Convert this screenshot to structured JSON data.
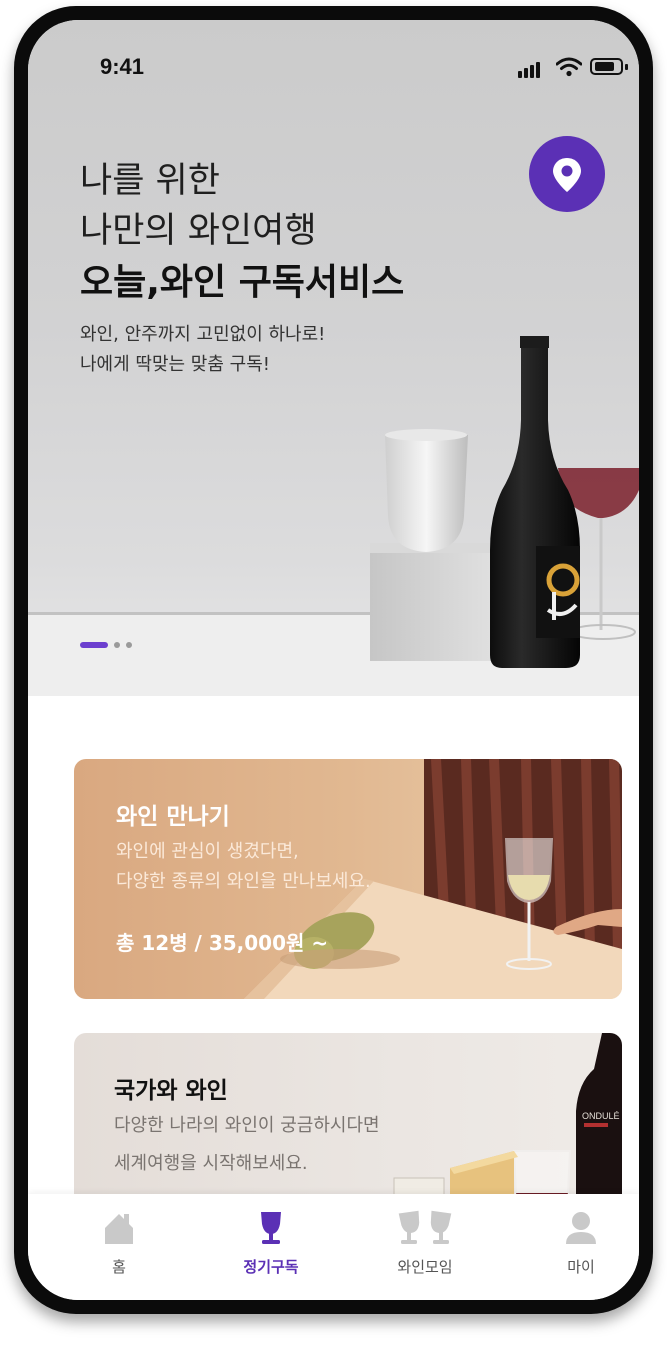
{
  "status": {
    "time": "9:41"
  },
  "hero": {
    "line1": "나를 위한",
    "line2": "나만의 와인여행",
    "line3": "오늘,와인 구독서비스",
    "desc1": "와인, 안주까지 고민없이  하나로!",
    "desc2": "나에게 딱맞는 맞춤 구독!",
    "location_icon": "location-pin-icon",
    "carousel": {
      "total": 3,
      "active": 1
    }
  },
  "cards": [
    {
      "title": "와인 만나기",
      "text1": "와인에 관심이 생겼다면,",
      "text2": "다양한 종류의 와인을 만나보세요.",
      "price": "총 12병 / 35,000원 ~"
    },
    {
      "title": "국가와 와인",
      "text1": "다양한 나라의 와인이 궁금하시다면",
      "text2": "세계여행을 시작해보세요.",
      "bottle_label": "ONDULÉ"
    }
  ],
  "tabs": [
    {
      "label": "홈",
      "icon": "home-icon"
    },
    {
      "label": "정기구독",
      "icon": "wine-glass-icon",
      "active": true
    },
    {
      "label": "와인모임",
      "icon": "wine-glasses-icon"
    },
    {
      "label": "마이",
      "icon": "user-icon"
    }
  ],
  "colors": {
    "accent": "#5b30b5",
    "card1": "#e1b891",
    "card2": "#ebe6e2"
  }
}
